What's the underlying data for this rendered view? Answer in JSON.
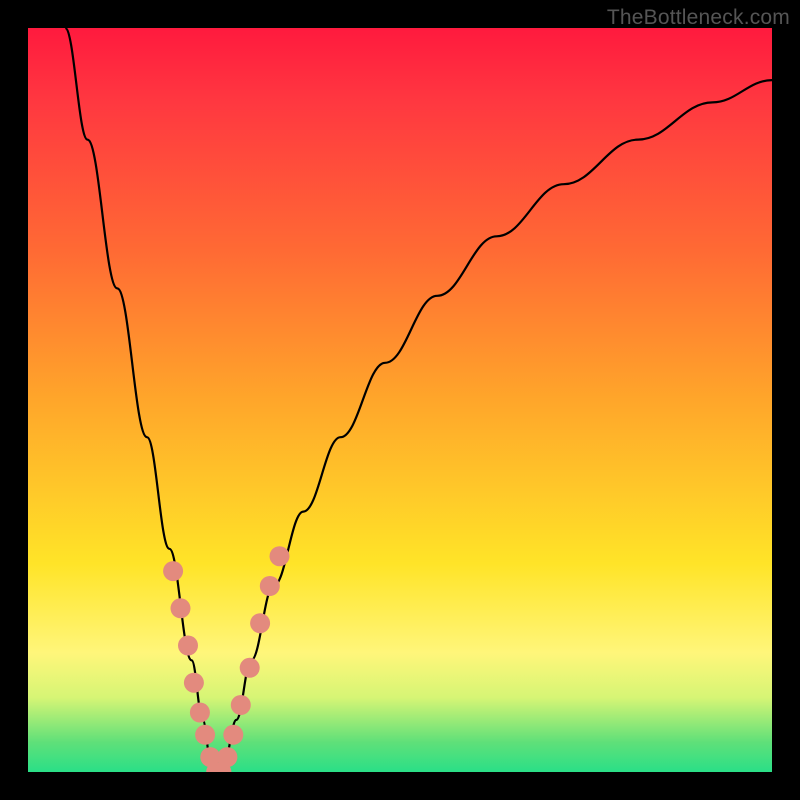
{
  "watermark": "TheBottleneck.com",
  "chart_data": {
    "type": "line",
    "title": "",
    "xlabel": "",
    "ylabel": "",
    "xlim": [
      0,
      100
    ],
    "ylim": [
      0,
      100
    ],
    "series": [
      {
        "name": "bottleneck-curve",
        "x": [
          5,
          8,
          12,
          16,
          19,
          22,
          23.5,
          24.5,
          25.5,
          26.5,
          28,
          30,
          33,
          37,
          42,
          48,
          55,
          63,
          72,
          82,
          92,
          100
        ],
        "values": [
          100,
          85,
          65,
          45,
          30,
          15,
          7,
          2,
          0,
          2,
          7,
          15,
          25,
          35,
          45,
          55,
          64,
          72,
          79,
          85,
          90,
          93
        ]
      }
    ],
    "markers": {
      "name": "highlight-dots",
      "color": "#e38a7e",
      "x": [
        19.5,
        20.5,
        21.5,
        22.3,
        23.1,
        23.8,
        24.5,
        25.3,
        26.0,
        26.8,
        27.6,
        28.6,
        29.8,
        31.2,
        32.5,
        33.8
      ],
      "values": [
        27,
        22,
        17,
        12,
        8,
        5,
        2,
        0,
        0,
        2,
        5,
        9,
        14,
        20,
        25,
        29
      ],
      "radius": 10
    },
    "gradient_stops": [
      {
        "pos": 0.0,
        "color": "#ff1a3e"
      },
      {
        "pos": 0.3,
        "color": "#ff6a34"
      },
      {
        "pos": 0.55,
        "color": "#ffc528"
      },
      {
        "pos": 0.8,
        "color": "#fff062"
      },
      {
        "pos": 0.94,
        "color": "#a2ee6e"
      },
      {
        "pos": 1.0,
        "color": "#2adf87"
      }
    ]
  }
}
